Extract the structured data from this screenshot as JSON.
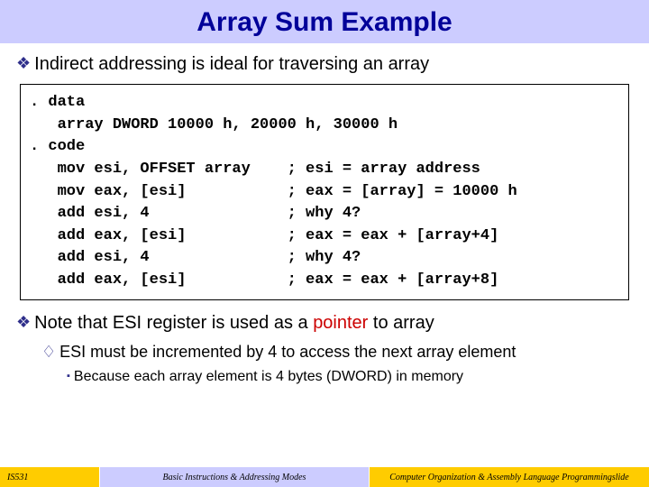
{
  "title": "Array Sum Example",
  "bullets": {
    "b1": "Indirect addressing is ideal for traversing an array",
    "b2_pre": "Note that ESI register is used as a ",
    "b2_pointer": "pointer",
    "b2_post": " to array",
    "sub1": "ESI must be incremented by 4 to access the next array element",
    "sub2": "Because each array element is 4 bytes (DWORD) in memory"
  },
  "code": ". data\n   array DWORD 10000 h, 20000 h, 30000 h\n. code\n   mov esi, OFFSET array    ; esi = array address\n   mov eax, [esi]           ; eax = [array] = 10000 h\n   add esi, 4               ; why 4?\n   add eax, [esi]           ; eax = eax + [array+4]\n   add esi, 4               ; why 4?\n   add eax, [esi]           ; eax = eax + [array+8]",
  "footer": {
    "left": "IS531",
    "mid": "Basic Instructions & Addressing Modes",
    "right": "Computer Organization & Assembly Language Programmingslide"
  }
}
